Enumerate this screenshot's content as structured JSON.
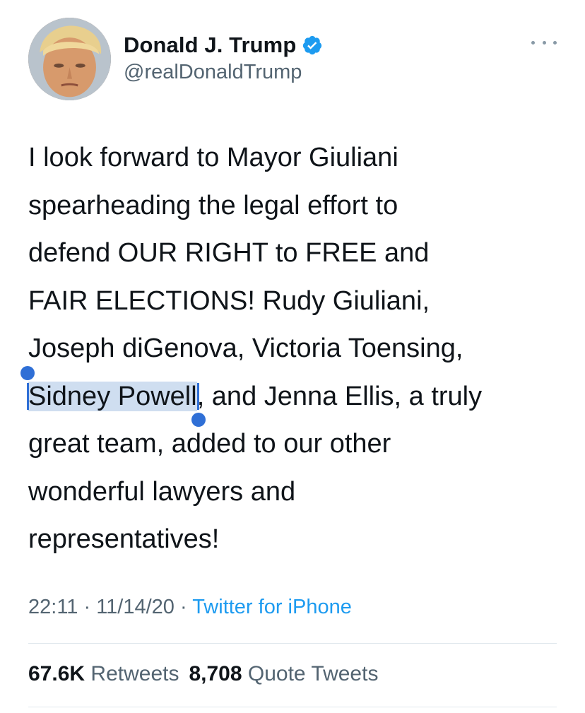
{
  "author": {
    "display_name": "Donald J. Trump",
    "handle": "@realDonaldTrump",
    "verified_icon": "verified-badge-icon",
    "avatar_icon": "profile-photo"
  },
  "more_icon": "more-options-icon",
  "tweet": {
    "lines": [
      {
        "text": "I look forward to Mayor Giuliani"
      },
      {
        "text": "spearheading the legal effort to"
      },
      {
        "text": "defend OUR RIGHT to FREE and"
      },
      {
        "text": "FAIR ELECTIONS! Rudy Giuliani,"
      },
      {
        "text": "Joseph diGenova, Victoria Toensing,"
      },
      {
        "selected": "Sidney Powell",
        "after": ", and Jenna Ellis, a truly"
      },
      {
        "text": "great team, added to our other"
      },
      {
        "text": "wonderful lawyers and"
      },
      {
        "text": "representatives!"
      }
    ]
  },
  "meta": {
    "time": "22:11",
    "separator": " · ",
    "date": "11/14/20",
    "source": "Twitter for iPhone"
  },
  "stats": {
    "retweets_count": "67.6K",
    "retweets_label": "Retweets",
    "quotes_count": "8,708",
    "quotes_label": "Quote Tweets"
  },
  "colors": {
    "accent": "#1d9bf0",
    "selection": "#cfdef0",
    "selection_handle": "#2f6fd6",
    "secondary_text": "#536471"
  }
}
